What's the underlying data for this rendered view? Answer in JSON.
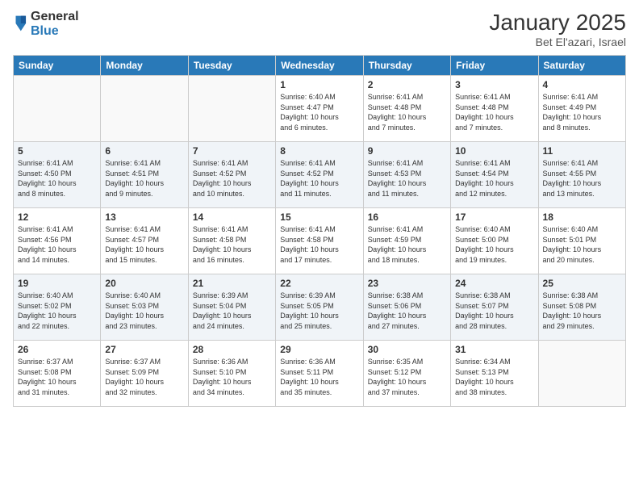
{
  "header": {
    "logo": {
      "general": "General",
      "blue": "Blue"
    },
    "title": "January 2025",
    "location": "Bet El'azari, Israel"
  },
  "days_of_week": [
    "Sunday",
    "Monday",
    "Tuesday",
    "Wednesday",
    "Thursday",
    "Friday",
    "Saturday"
  ],
  "weeks": [
    [
      {
        "day": "",
        "info": ""
      },
      {
        "day": "",
        "info": ""
      },
      {
        "day": "",
        "info": ""
      },
      {
        "day": "1",
        "info": "Sunrise: 6:40 AM\nSunset: 4:47 PM\nDaylight: 10 hours\nand 6 minutes."
      },
      {
        "day": "2",
        "info": "Sunrise: 6:41 AM\nSunset: 4:48 PM\nDaylight: 10 hours\nand 7 minutes."
      },
      {
        "day": "3",
        "info": "Sunrise: 6:41 AM\nSunset: 4:48 PM\nDaylight: 10 hours\nand 7 minutes."
      },
      {
        "day": "4",
        "info": "Sunrise: 6:41 AM\nSunset: 4:49 PM\nDaylight: 10 hours\nand 8 minutes."
      }
    ],
    [
      {
        "day": "5",
        "info": "Sunrise: 6:41 AM\nSunset: 4:50 PM\nDaylight: 10 hours\nand 8 minutes."
      },
      {
        "day": "6",
        "info": "Sunrise: 6:41 AM\nSunset: 4:51 PM\nDaylight: 10 hours\nand 9 minutes."
      },
      {
        "day": "7",
        "info": "Sunrise: 6:41 AM\nSunset: 4:52 PM\nDaylight: 10 hours\nand 10 minutes."
      },
      {
        "day": "8",
        "info": "Sunrise: 6:41 AM\nSunset: 4:52 PM\nDaylight: 10 hours\nand 11 minutes."
      },
      {
        "day": "9",
        "info": "Sunrise: 6:41 AM\nSunset: 4:53 PM\nDaylight: 10 hours\nand 11 minutes."
      },
      {
        "day": "10",
        "info": "Sunrise: 6:41 AM\nSunset: 4:54 PM\nDaylight: 10 hours\nand 12 minutes."
      },
      {
        "day": "11",
        "info": "Sunrise: 6:41 AM\nSunset: 4:55 PM\nDaylight: 10 hours\nand 13 minutes."
      }
    ],
    [
      {
        "day": "12",
        "info": "Sunrise: 6:41 AM\nSunset: 4:56 PM\nDaylight: 10 hours\nand 14 minutes."
      },
      {
        "day": "13",
        "info": "Sunrise: 6:41 AM\nSunset: 4:57 PM\nDaylight: 10 hours\nand 15 minutes."
      },
      {
        "day": "14",
        "info": "Sunrise: 6:41 AM\nSunset: 4:58 PM\nDaylight: 10 hours\nand 16 minutes."
      },
      {
        "day": "15",
        "info": "Sunrise: 6:41 AM\nSunset: 4:58 PM\nDaylight: 10 hours\nand 17 minutes."
      },
      {
        "day": "16",
        "info": "Sunrise: 6:41 AM\nSunset: 4:59 PM\nDaylight: 10 hours\nand 18 minutes."
      },
      {
        "day": "17",
        "info": "Sunrise: 6:40 AM\nSunset: 5:00 PM\nDaylight: 10 hours\nand 19 minutes."
      },
      {
        "day": "18",
        "info": "Sunrise: 6:40 AM\nSunset: 5:01 PM\nDaylight: 10 hours\nand 20 minutes."
      }
    ],
    [
      {
        "day": "19",
        "info": "Sunrise: 6:40 AM\nSunset: 5:02 PM\nDaylight: 10 hours\nand 22 minutes."
      },
      {
        "day": "20",
        "info": "Sunrise: 6:40 AM\nSunset: 5:03 PM\nDaylight: 10 hours\nand 23 minutes."
      },
      {
        "day": "21",
        "info": "Sunrise: 6:39 AM\nSunset: 5:04 PM\nDaylight: 10 hours\nand 24 minutes."
      },
      {
        "day": "22",
        "info": "Sunrise: 6:39 AM\nSunset: 5:05 PM\nDaylight: 10 hours\nand 25 minutes."
      },
      {
        "day": "23",
        "info": "Sunrise: 6:38 AM\nSunset: 5:06 PM\nDaylight: 10 hours\nand 27 minutes."
      },
      {
        "day": "24",
        "info": "Sunrise: 6:38 AM\nSunset: 5:07 PM\nDaylight: 10 hours\nand 28 minutes."
      },
      {
        "day": "25",
        "info": "Sunrise: 6:38 AM\nSunset: 5:08 PM\nDaylight: 10 hours\nand 29 minutes."
      }
    ],
    [
      {
        "day": "26",
        "info": "Sunrise: 6:37 AM\nSunset: 5:08 PM\nDaylight: 10 hours\nand 31 minutes."
      },
      {
        "day": "27",
        "info": "Sunrise: 6:37 AM\nSunset: 5:09 PM\nDaylight: 10 hours\nand 32 minutes."
      },
      {
        "day": "28",
        "info": "Sunrise: 6:36 AM\nSunset: 5:10 PM\nDaylight: 10 hours\nand 34 minutes."
      },
      {
        "day": "29",
        "info": "Sunrise: 6:36 AM\nSunset: 5:11 PM\nDaylight: 10 hours\nand 35 minutes."
      },
      {
        "day": "30",
        "info": "Sunrise: 6:35 AM\nSunset: 5:12 PM\nDaylight: 10 hours\nand 37 minutes."
      },
      {
        "day": "31",
        "info": "Sunrise: 6:34 AM\nSunset: 5:13 PM\nDaylight: 10 hours\nand 38 minutes."
      },
      {
        "day": "",
        "info": ""
      }
    ]
  ]
}
